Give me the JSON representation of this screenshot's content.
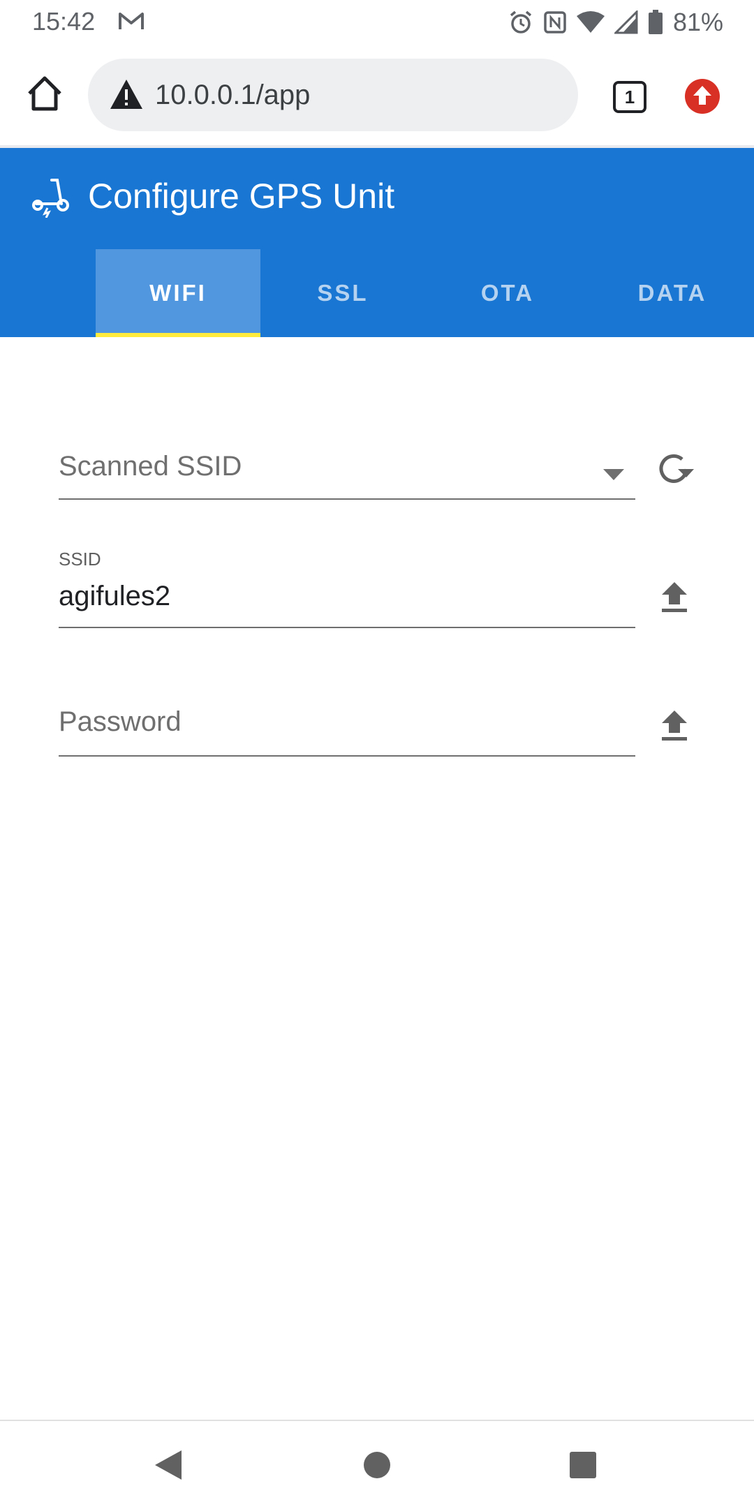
{
  "status_bar": {
    "time": "15:42",
    "notification_icon": "gmail-icon",
    "icons": [
      "alarm-icon",
      "nfc-icon",
      "wifi-icon",
      "signal-icon",
      "battery-icon"
    ],
    "battery_level": "81%"
  },
  "browser": {
    "url": "10.0.0.1/app",
    "security_icon": "warning-icon",
    "tab_count": "1",
    "update_icon": "update-available-icon"
  },
  "app": {
    "title": "Configure GPS Unit",
    "logo_icon": "scooter-icon",
    "brand_color": "#1976d2",
    "indicator_color": "#ffeb3b",
    "tabs": [
      {
        "label": "WIFI",
        "active": true
      },
      {
        "label": "SSL",
        "active": false
      },
      {
        "label": "OTA",
        "active": false
      },
      {
        "label": "DATA",
        "active": false
      }
    ]
  },
  "form": {
    "scanned_ssid": {
      "placeholder": "Scanned SSID",
      "action_icon": "refresh-icon"
    },
    "ssid": {
      "label": "SSID",
      "value": "agifules2",
      "action_icon": "upload-icon"
    },
    "password": {
      "placeholder": "Password",
      "action_icon": "upload-icon"
    }
  },
  "nav_bar": {
    "icons": [
      "back-icon",
      "home-icon",
      "recents-icon"
    ]
  }
}
